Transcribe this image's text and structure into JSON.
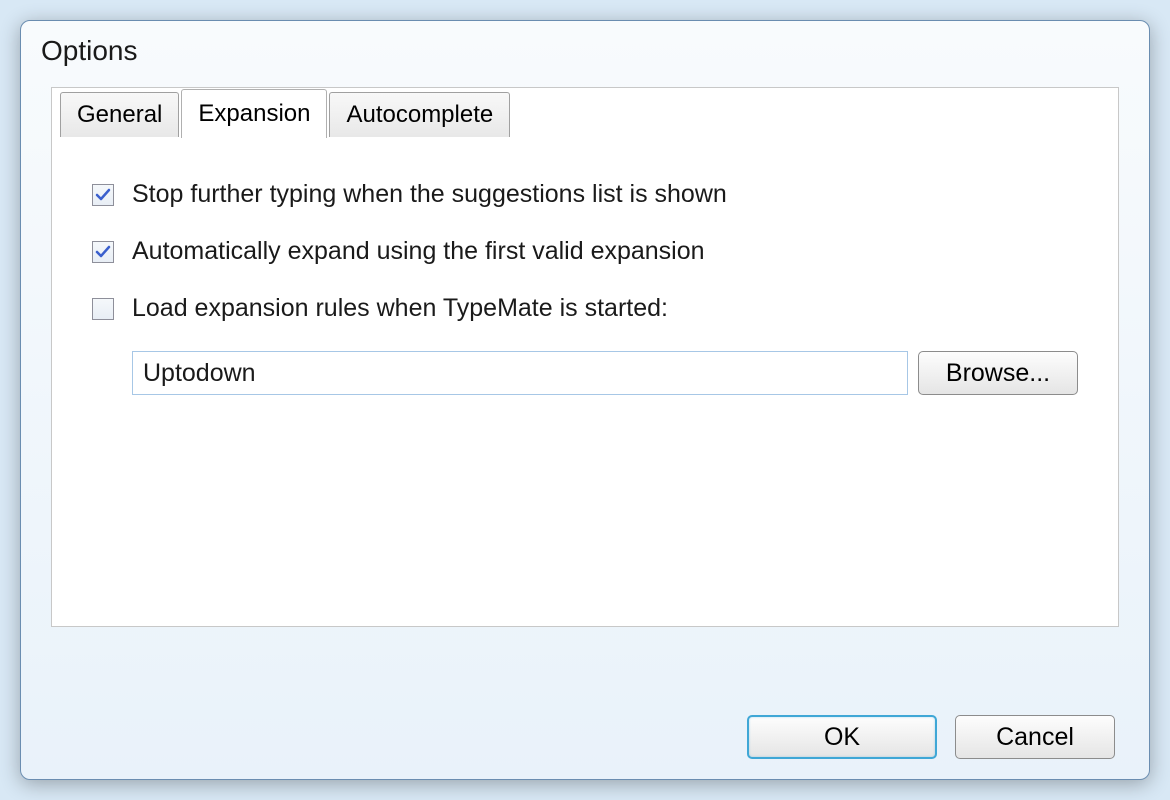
{
  "dialog": {
    "title": "Options"
  },
  "tabs": {
    "general": "General",
    "expansion": "Expansion",
    "autocomplete": "Autocomplete"
  },
  "options": {
    "stopTyping": {
      "label": "Stop further typing when the suggestions list is shown",
      "checked": true
    },
    "autoExpand": {
      "label": "Automatically expand using the first valid expansion",
      "checked": true
    },
    "loadRules": {
      "label": "Load expansion rules when TypeMate is started:",
      "checked": false
    },
    "rulesPath": "Uptodown",
    "browseLabel": "Browse..."
  },
  "buttons": {
    "ok": "OK",
    "cancel": "Cancel"
  }
}
